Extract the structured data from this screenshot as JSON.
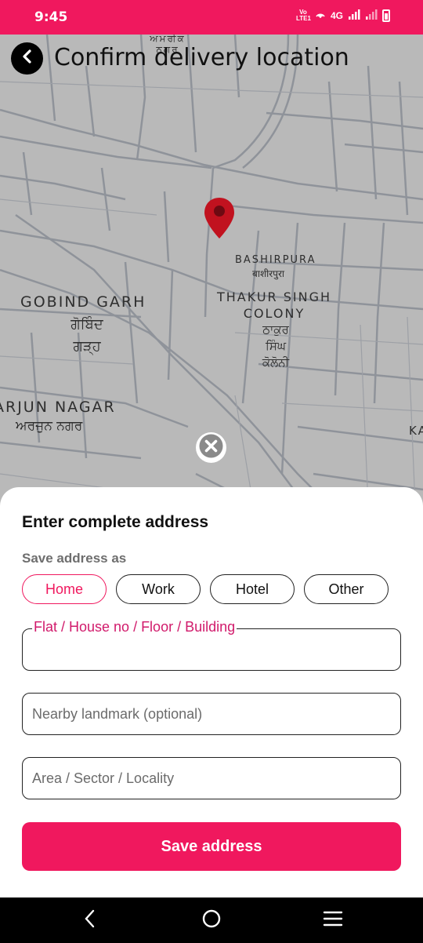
{
  "status_bar": {
    "time": "9:45",
    "indicators": [
      "volte-icon",
      "hotspot-icon",
      "4G",
      "signal-icon",
      "signal-weak-icon",
      "battery-icon"
    ],
    "network": "4G",
    "volte_text": "Vo LTE1",
    "color": "#f0185e"
  },
  "header": {
    "title": "Confirm delivery location",
    "back_icon": "chevron-left-icon"
  },
  "map": {
    "labels": {
      "top_label": "ਅਮਰੀਕ ਨਗਰ",
      "bashirpura": "BASHIRPURA",
      "bashirpura_local": "बाशीरपुरा",
      "gobind_garh": "GOBIND GARH",
      "gobind_garh_local": "ਗੋਬਿੰਦ ਗੜ੍ਹ",
      "thakur_singh": "THAKUR SINGH COLONY",
      "thakur_singh_local": "ਠਾਕੁਰ ਸਿੰਘ ਕੋਲੋਨੀ",
      "arjun_nagar": "ARJUN NAGAR",
      "arjun_nagar_local": "ਅਰਜੁਨ ਨਗਰ",
      "edge_label": "KA"
    },
    "pin_icon": "location-pin-icon",
    "close_icon": "close-icon",
    "pin_color": "#c1121f"
  },
  "sheet": {
    "title": "Enter complete address",
    "save_as_label": "Save address as",
    "chips": [
      "Home",
      "Work",
      "Hotel",
      "Other"
    ],
    "selected_chip": "Home",
    "fields": {
      "flat": {
        "label": "Flat / House no / Floor / Building",
        "value": ""
      },
      "landmark": {
        "placeholder": "Nearby landmark (optional)",
        "value": ""
      },
      "area": {
        "placeholder": "Area / Sector / Locality",
        "value": ""
      }
    },
    "save_button": "Save address",
    "accent": "#f0185e"
  },
  "nav_bar": {
    "items": [
      "back-icon",
      "home-icon",
      "menu-icon"
    ]
  }
}
